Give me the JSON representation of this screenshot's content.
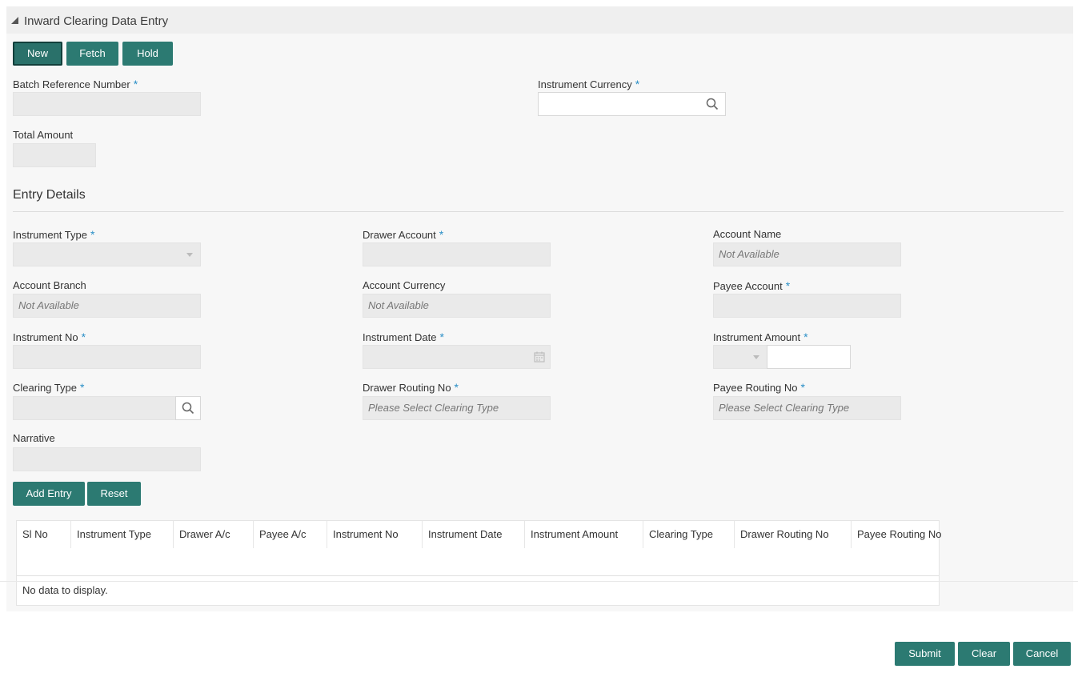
{
  "header": {
    "title": "Inward Clearing Data Entry"
  },
  "toolbar": {
    "new_label": "New",
    "fetch_label": "Fetch",
    "hold_label": "Hold"
  },
  "batch": {
    "batch_reference_label": "Batch Reference Number",
    "batch_reference_value": "",
    "instrument_currency_label": "Instrument Currency",
    "instrument_currency_value": "",
    "total_amount_label": "Total Amount",
    "total_amount_value": ""
  },
  "entry": {
    "section_title": "Entry Details",
    "instrument_type_label": "Instrument Type",
    "instrument_type_value": "",
    "drawer_account_label": "Drawer Account",
    "account_name_label": "Account Name",
    "account_name_value": "Not Available",
    "account_branch_label": "Account Branch",
    "account_branch_value": "Not Available",
    "account_currency_label": "Account Currency",
    "account_currency_value": "Not Available",
    "payee_account_label": "Payee Account",
    "instrument_no_label": "Instrument No",
    "instrument_date_label": "Instrument Date",
    "instrument_date_value": "",
    "instrument_amount_label": "Instrument Amount",
    "clearing_type_label": "Clearing Type",
    "drawer_routing_label": "Drawer Routing No",
    "drawer_routing_value": "Please Select Clearing Type",
    "payee_routing_label": "Payee Routing No",
    "payee_routing_value": "Please Select Clearing Type",
    "narrative_label": "Narrative",
    "add_entry_label": "Add Entry",
    "reset_label": "Reset",
    "required_mark": "*"
  },
  "table": {
    "columns": [
      "Sl No",
      "Instrument Type",
      "Drawer A/c",
      "Payee A/c",
      "Instrument No",
      "Instrument Date",
      "Instrument Amount",
      "Clearing Type",
      "Drawer Routing No",
      "Payee Routing No"
    ],
    "empty_text": "No data to display."
  },
  "footer": {
    "submit_label": "Submit",
    "clear_label": "Clear",
    "cancel_label": "Cancel"
  },
  "colors": {
    "primary": "#2c7a72",
    "required": "#2b8fc7",
    "field_bg": "#eaeaea",
    "panel_bg": "#f7f7f7"
  }
}
